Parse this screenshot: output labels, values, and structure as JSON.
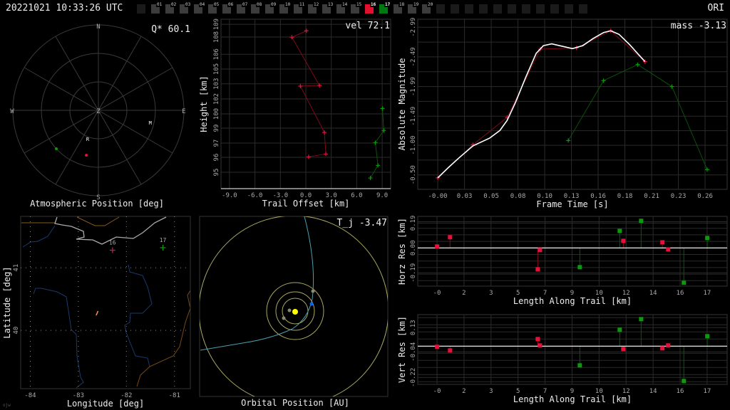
{
  "header": {
    "timestamp": "20221021 10:33:26 UTC",
    "station": "ORI"
  },
  "signature": "ojw",
  "cameras": [
    {
      "label": "",
      "state": "empty"
    },
    {
      "label": "01",
      "state": "off"
    },
    {
      "label": "02",
      "state": "off"
    },
    {
      "label": "03",
      "state": "off"
    },
    {
      "label": "04",
      "state": "off"
    },
    {
      "label": "05",
      "state": "off"
    },
    {
      "label": "06",
      "state": "off"
    },
    {
      "label": "07",
      "state": "off"
    },
    {
      "label": "08",
      "state": "off"
    },
    {
      "label": "09",
      "state": "off"
    },
    {
      "label": "10",
      "state": "off"
    },
    {
      "label": "11",
      "state": "off"
    },
    {
      "label": "12",
      "state": "off"
    },
    {
      "label": "13",
      "state": "off"
    },
    {
      "label": "14",
      "state": "off"
    },
    {
      "label": "15",
      "state": "off"
    },
    {
      "label": "16",
      "state": "red"
    },
    {
      "label": "17",
      "state": "green"
    },
    {
      "label": "18",
      "state": "off"
    },
    {
      "label": "19",
      "state": "off"
    },
    {
      "label": "20",
      "state": "off"
    },
    {
      "label": "",
      "state": "empty"
    },
    {
      "label": "",
      "state": "empty"
    },
    {
      "label": "",
      "state": "empty"
    },
    {
      "label": "",
      "state": "empty"
    },
    {
      "label": "",
      "state": "empty"
    },
    {
      "label": "",
      "state": "empty"
    },
    {
      "label": "",
      "state": "empty"
    },
    {
      "label": "",
      "state": "empty"
    },
    {
      "label": "",
      "state": "empty"
    },
    {
      "label": "",
      "state": "empty"
    },
    {
      "label": "",
      "state": "empty"
    }
  ],
  "colors": {
    "cam16": "#e8103a",
    "cam16_line": "#8b0a1a",
    "cam17": "#0a9a0a",
    "cam17_line": "#0a5a0a",
    "fit": "#ffffff",
    "grid": "#2b2b2b",
    "orbit": "#a8a860",
    "meteoroid": "#4aa0b0",
    "earth": "#1060ff",
    "sun": "#ffff00"
  },
  "chart_data": [
    {
      "type": "polar",
      "title": "Atmospheric Position [deg]",
      "annotation": "Q* 60.1",
      "directions": {
        "N": "N",
        "E": "E",
        "S": "S",
        "W": "W",
        "center": "Z"
      },
      "rings_deg": [
        30,
        60,
        90
      ],
      "points": [
        {
          "label": "R",
          "az": 200.6,
          "zen": 32,
          "kind": "text"
        },
        {
          "label": "M",
          "az": 103,
          "zen": 56,
          "kind": "text"
        },
        {
          "label": "",
          "az": 195,
          "zen": 49,
          "kind": "cam16"
        },
        {
          "label": "",
          "az": 227.5,
          "zen": 60,
          "kind": "cam17"
        }
      ]
    },
    {
      "type": "line",
      "title": "vel 72.1",
      "xlabel": "Trail Offset [km]",
      "ylabel": "Height [km]",
      "xlim": [
        -10,
        10
      ],
      "ylim": [
        93.45,
        109.53
      ],
      "xticks": [
        {
          "v": -9,
          "t": "-9.0"
        },
        {
          "v": -6,
          "t": "-6.0"
        },
        {
          "v": -3,
          "t": "-3.0"
        },
        {
          "v": 0,
          "t": "0.0"
        },
        {
          "v": 3,
          "t": "3.0"
        },
        {
          "v": 6,
          "t": "6.0"
        },
        {
          "v": 9,
          "t": "9.0"
        }
      ],
      "yticks": [
        {
          "v": 95,
          "t": "95"
        },
        {
          "v": 96.42,
          "t": "96"
        },
        {
          "v": 97.77,
          "t": "97"
        },
        {
          "v": 99.19,
          "t": "99"
        },
        {
          "v": 100.54,
          "t": "100"
        },
        {
          "v": 101.96,
          "t": "102"
        },
        {
          "v": 103.4,
          "t": "103"
        },
        {
          "v": 104.8,
          "t": "105"
        },
        {
          "v": 106.2,
          "t": "106"
        },
        {
          "v": 107.84,
          "t": "108"
        },
        {
          "v": 109.05,
          "t": "109"
        }
      ],
      "series": [
        {
          "name": "16",
          "color": "cam16",
          "x": [
            0.06,
            -1.64,
            1.61,
            -0.64,
            2.19,
            2.36,
            0.33
          ],
          "y": [
            108.43,
            107.82,
            103.24,
            103.18,
            98.78,
            96.74,
            96.47
          ]
        },
        {
          "name": "17",
          "color": "cam17",
          "x": [
            9.03,
            9.19,
            8.19,
            8.5,
            7.61
          ],
          "y": [
            101.06,
            98.97,
            97.82,
            95.66,
            94.46
          ]
        }
      ]
    },
    {
      "type": "line",
      "title": "mass -3.13",
      "xlabel": "Frame Time [s]",
      "ylabel": "Absolute Magnitude",
      "xlim": [
        -0.0193,
        0.2793
      ],
      "ylim": [
        -0.257,
        -3.125
      ],
      "inverted_y": true,
      "xticks": [
        {
          "v": 0,
          "t": "-0.00"
        },
        {
          "v": 0.0258,
          "t": "0.03"
        },
        {
          "v": 0.0516,
          "t": "0.05"
        },
        {
          "v": 0.0774,
          "t": "0.08"
        },
        {
          "v": 0.1032,
          "t": "0.10"
        },
        {
          "v": 0.129,
          "t": "0.13"
        },
        {
          "v": 0.1548,
          "t": "0.16"
        },
        {
          "v": 0.1806,
          "t": "0.18"
        },
        {
          "v": 0.2064,
          "t": "0.21"
        },
        {
          "v": 0.2322,
          "t": "0.23"
        },
        {
          "v": 0.258,
          "t": "0.26"
        }
      ],
      "yticks": [
        {
          "v": -0.5,
          "t": "-0.50"
        },
        {
          "v": -1.0,
          "t": "-1.00"
        },
        {
          "v": -1.49,
          "t": "-1.49"
        },
        {
          "v": -1.99,
          "t": "-1.99"
        },
        {
          "v": -2.49,
          "t": "-2.49"
        },
        {
          "v": -2.99,
          "t": "-2.99"
        }
      ],
      "series": [
        {
          "name": "16",
          "color": "cam16",
          "x": [
            0,
            0.034,
            0.067,
            0.099,
            0.134,
            0.167,
            0.2
          ],
          "y": [
            -0.45,
            -1.01,
            -1.47,
            -2.62,
            -2.64,
            -2.93,
            -2.41
          ]
        },
        {
          "name": "17",
          "color": "cam17",
          "x": [
            0.126,
            0.16,
            0.193,
            0.226,
            0.26
          ],
          "y": [
            -1.08,
            -2.09,
            -2.36,
            -1.99,
            -0.59
          ]
        },
        {
          "name": "fit",
          "color": "fit",
          "x": [
            0,
            0.01,
            0.02,
            0.034,
            0.05,
            0.06,
            0.067,
            0.075,
            0.085,
            0.095,
            0.102,
            0.11,
            0.12,
            0.13,
            0.14,
            0.15,
            0.16,
            0.167,
            0.175,
            0.185,
            0.2
          ],
          "y": [
            -0.45,
            -0.62,
            -0.78,
            -0.99,
            -1.12,
            -1.25,
            -1.42,
            -1.72,
            -2.15,
            -2.55,
            -2.68,
            -2.71,
            -2.67,
            -2.63,
            -2.68,
            -2.8,
            -2.9,
            -2.93,
            -2.87,
            -2.7,
            -2.41
          ]
        }
      ]
    },
    {
      "type": "map",
      "xlabel": "Longitude [deg]",
      "ylabel": "Latitude [deg]",
      "xlim": [
        -84.2,
        -80.67
      ],
      "ylim": [
        39.07,
        41.82
      ],
      "xticks": [
        {
          "v": -84,
          "t": "-84"
        },
        {
          "v": -83,
          "t": "-83"
        },
        {
          "v": -82,
          "t": "-82"
        },
        {
          "v": -81,
          "t": "-81"
        }
      ],
      "yticks": [
        {
          "v": 40,
          "t": "40"
        },
        {
          "v": 41,
          "t": "41"
        }
      ],
      "stations": [
        {
          "label": "16",
          "lon": -82.29,
          "lat": 41.28,
          "color": "cam16"
        },
        {
          "label": "17",
          "lon": -81.24,
          "lat": 41.32,
          "color": "cam17"
        }
      ],
      "track": {
        "lon": [
          -82.63,
          -82.59
        ],
        "lat": [
          40.24,
          40.31
        ]
      }
    },
    {
      "type": "orbit",
      "title": "Orbital Position [AU]",
      "annotation": "T_j -3.47"
    },
    {
      "type": "stem",
      "xlabel": "Length Along Trail [km]",
      "ylabel": "Horz Res [km]",
      "xlim": [
        -1.24,
        18.69
      ],
      "ylim": [
        -0.292,
        0.241
      ],
      "xticks": [
        {
          "v": 0,
          "t": "-0"
        },
        {
          "v": 1.74,
          "t": "2"
        },
        {
          "v": 3.48,
          "t": "3"
        },
        {
          "v": 5.22,
          "t": "5"
        },
        {
          "v": 6.96,
          "t": "7"
        },
        {
          "v": 8.7,
          "t": "9"
        },
        {
          "v": 10.44,
          "t": "10"
        },
        {
          "v": 12.18,
          "t": "12"
        },
        {
          "v": 13.92,
          "t": "14"
        },
        {
          "v": 15.66,
          "t": "16"
        },
        {
          "v": 17.4,
          "t": "17"
        }
      ],
      "yticks": [
        {
          "v": -0.19,
          "t": "-0.19"
        },
        {
          "v": 0,
          "t": "0.00"
        },
        {
          "v": 0.19,
          "t": "0.19"
        }
      ],
      "series": [
        {
          "name": "16",
          "color": "cam16",
          "x": [
            0.01,
            0.84,
            6.49,
            6.63,
            12.0,
            14.52,
            14.89
          ],
          "y": [
            0.011,
            0.082,
            -0.163,
            -0.016,
            0.054,
            0.043,
            -0.011
          ]
        },
        {
          "name": "17",
          "color": "cam17",
          "x": [
            9.2,
            11.77,
            13.15,
            15.9,
            17.41
          ],
          "y": [
            -0.147,
            0.13,
            0.207,
            -0.266,
            0.076
          ]
        }
      ]
    },
    {
      "type": "stem",
      "xlabel": "Length Along Trail [km]",
      "ylabel": "Vert Res [km]",
      "xlim": [
        -1.24,
        18.69
      ],
      "ylim": [
        -0.2685,
        0.2215
      ],
      "xticks": [
        {
          "v": 0,
          "t": "-0"
        },
        {
          "v": 1.74,
          "t": "2"
        },
        {
          "v": 3.48,
          "t": "3"
        },
        {
          "v": 5.22,
          "t": "5"
        },
        {
          "v": 6.96,
          "t": "7"
        },
        {
          "v": 8.7,
          "t": "9"
        },
        {
          "v": 10.44,
          "t": "10"
        },
        {
          "v": 12.18,
          "t": "12"
        },
        {
          "v": 13.92,
          "t": "14"
        },
        {
          "v": 15.66,
          "t": "16"
        },
        {
          "v": 17.4,
          "t": "17"
        }
      ],
      "yticks": [
        {
          "v": -0.22,
          "t": "-0.22"
        },
        {
          "v": -0.04,
          "t": "-0.04"
        },
        {
          "v": 0.13,
          "t": "0.13"
        }
      ],
      "series": [
        {
          "name": "16",
          "color": "cam16",
          "x": [
            0.01,
            0.84,
            6.49,
            6.63,
            12.0,
            14.52,
            14.89
          ],
          "y": [
            -0.005,
            -0.03,
            0.05,
            0.005,
            -0.02,
            -0.015,
            0.005
          ]
        },
        {
          "name": "17",
          "color": "cam17",
          "x": [
            9.2,
            11.77,
            13.15,
            15.9,
            17.41
          ],
          "y": [
            -0.135,
            0.115,
            0.19,
            -0.245,
            0.07
          ]
        }
      ]
    }
  ]
}
